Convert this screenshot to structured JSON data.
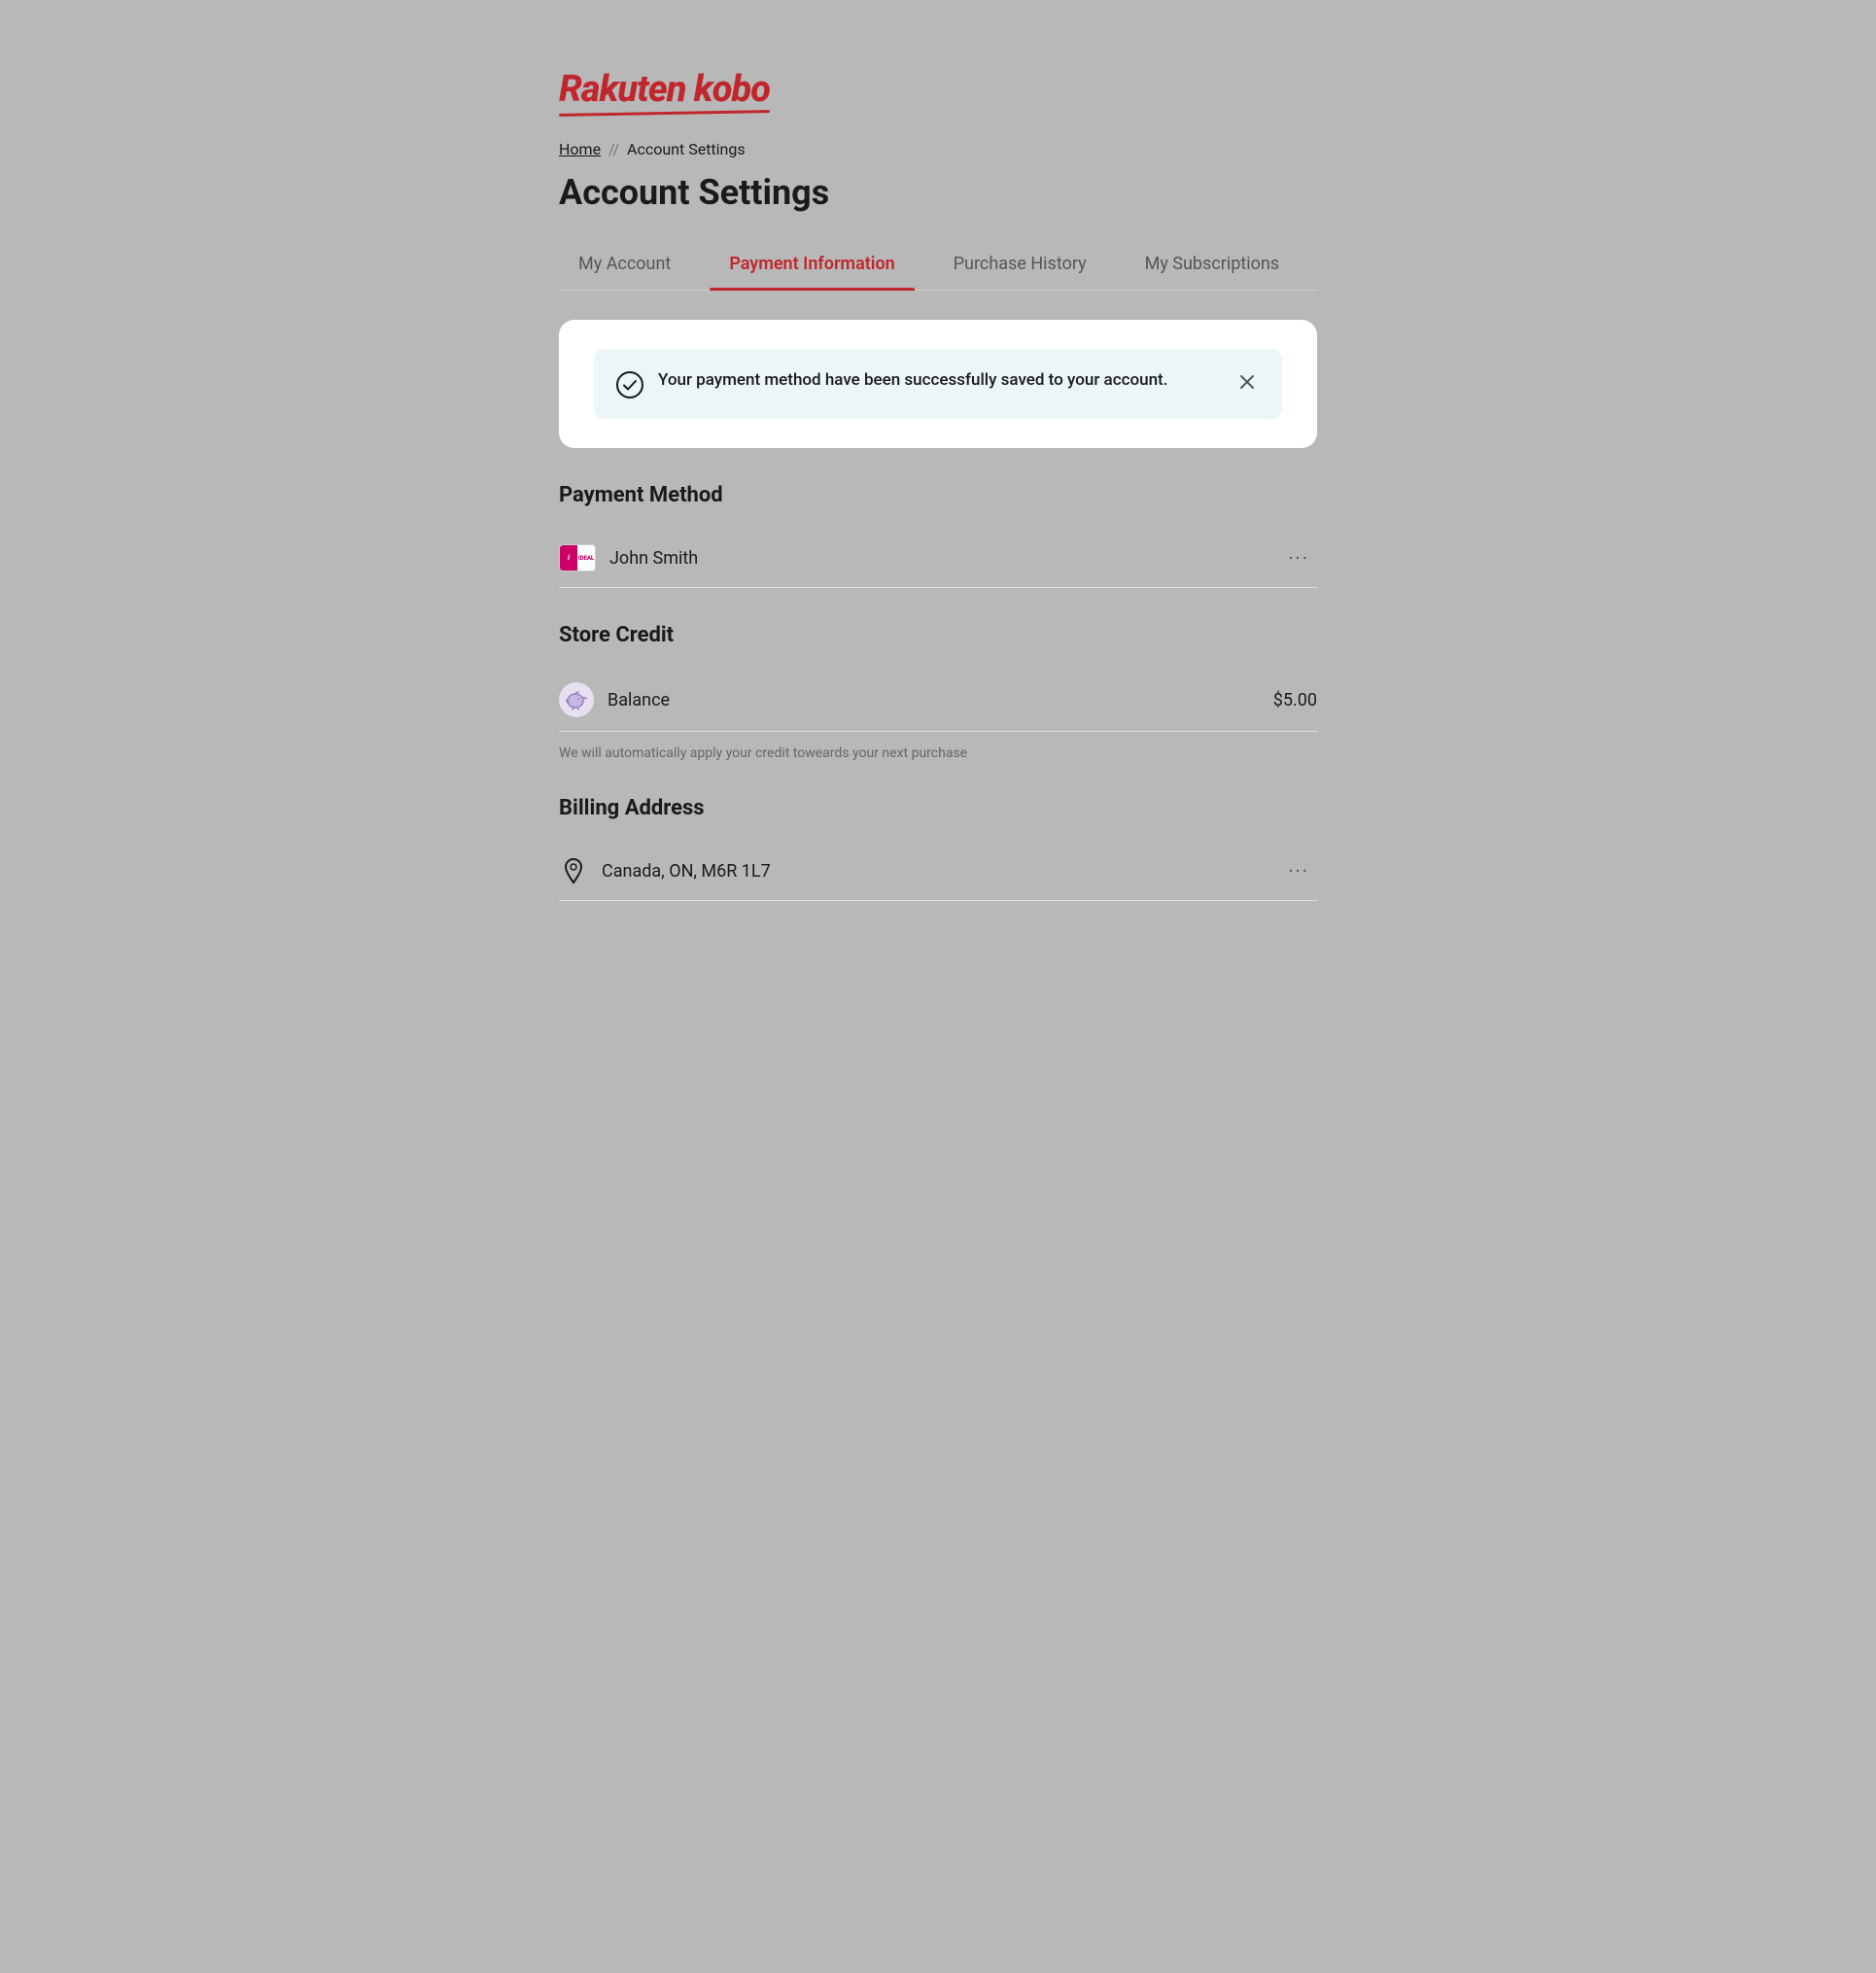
{
  "logo": {
    "text": "Rakuten kobo"
  },
  "breadcrumb": {
    "home_label": "Home",
    "separator": "//",
    "current": "Account Settings"
  },
  "page_title": "Account Settings",
  "tabs": [
    {
      "id": "my-account",
      "label": "My Account",
      "active": false
    },
    {
      "id": "payment-information",
      "label": "Payment Information",
      "active": true
    },
    {
      "id": "purchase-history",
      "label": "Purchase History",
      "active": false
    },
    {
      "id": "my-subscriptions",
      "label": "My Subscriptions",
      "active": false
    }
  ],
  "success_banner": {
    "message": "Your payment method have been successfully saved to your account.",
    "close_label": "×"
  },
  "payment_method": {
    "section_title": "Payment Method",
    "name": "John Smith",
    "dots_menu": "···"
  },
  "store_credit": {
    "section_title": "Store Credit",
    "balance_label": "Balance",
    "balance_amount": "$5.00",
    "note": "We will automatically apply your credit toweards your next purchase"
  },
  "billing_address": {
    "section_title": "Billing Address",
    "address": "Canada, ON, M6R 1L7",
    "dots_menu": "···"
  }
}
